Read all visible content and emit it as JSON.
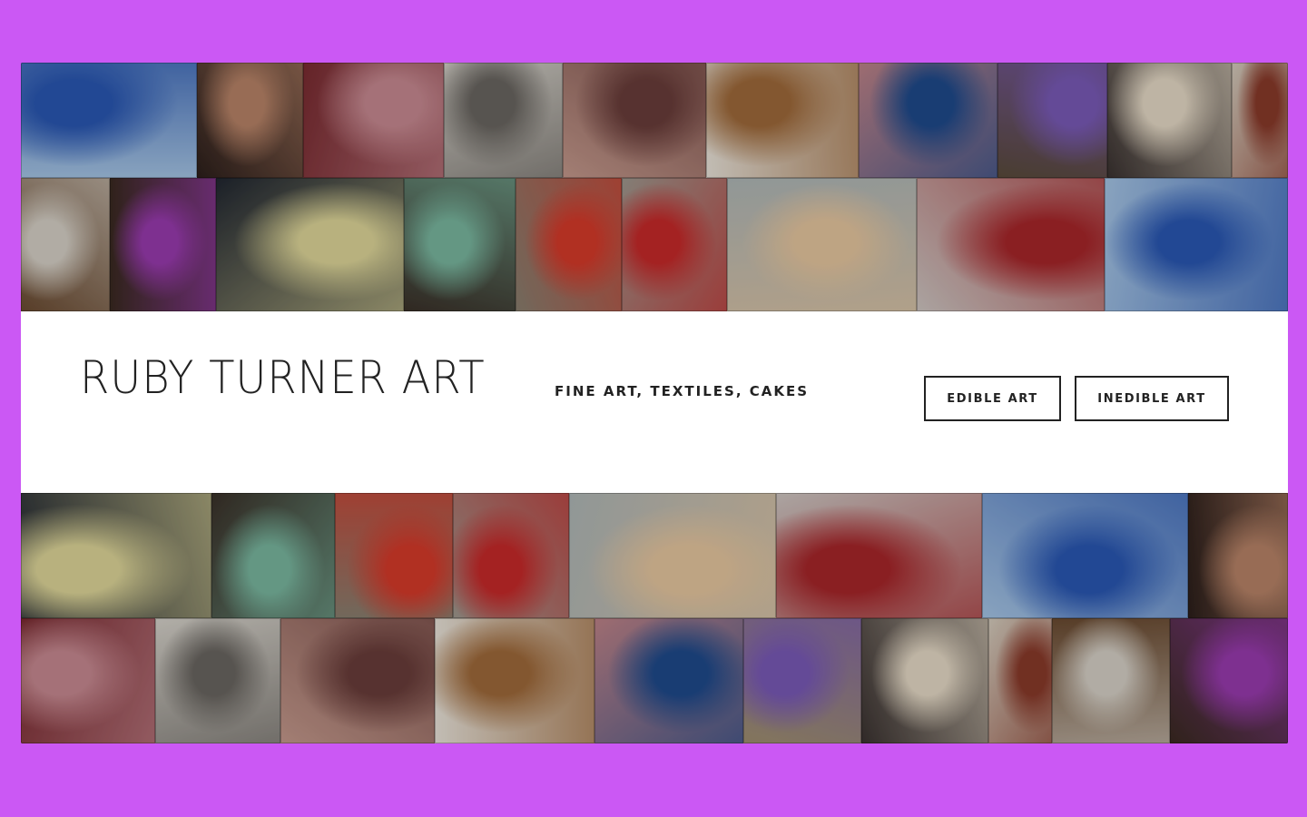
{
  "site": {
    "title": "RUBY TURNER ART",
    "tagline": "FINE ART, TEXTILES, CAKES"
  },
  "nav": {
    "edible_label": "EDIBLE ART",
    "inedible_label": "INEDIBLE ART"
  },
  "colors": {
    "page_background": "#cb58f4",
    "hero_background": "#ffffff",
    "text": "#222222"
  },
  "gallery": {
    "rows": [
      [
        {
          "subject": "water-droplet-painting",
          "colors": [
            "#a7c7e8",
            "#2a58b4"
          ]
        },
        {
          "subject": "woman-portrait-painting",
          "colors": [
            "#2b1e1a",
            "#b98468"
          ]
        },
        {
          "subject": "lips-painting",
          "colors": [
            "#7a2a30",
            "#c98a92"
          ]
        },
        {
          "subject": "man-pencil-sketch",
          "colors": [
            "#d8d4cc",
            "#6a6661"
          ]
        },
        {
          "subject": "face-closeup-painting",
          "colors": [
            "#c79b8e",
            "#6a3d3a"
          ]
        },
        {
          "subject": "clay-charms",
          "colors": [
            "#ece6dc",
            "#a06a3a"
          ]
        },
        {
          "subject": "blue-eye-painting",
          "colors": [
            "#c0848a",
            "#1e4a8c"
          ]
        },
        {
          "subject": "torso-vase-flowers",
          "colors": [
            "#5a4a3a",
            "#7a5ab8"
          ]
        },
        {
          "subject": "wedding-cake-orchids",
          "colors": [
            "#3a3230",
            "#e8dcc8"
          ]
        },
        {
          "subject": "geisha-mosaic",
          "colors": [
            "#d8cfc0",
            "#8a3a2a"
          ]
        }
      ],
      [
        {
          "subject": "torso-sculpture",
          "colors": [
            "#6a4a30",
            "#d8d2c8"
          ]
        },
        {
          "subject": "torso-vase-flowers",
          "colors": [
            "#3a2a20",
            "#9a3ab0"
          ]
        },
        {
          "subject": "tiered-cake-orange-roses",
          "colors": [
            "#202630",
            "#e0d89a"
          ]
        },
        {
          "subject": "mint-green-cake",
          "colors": [
            "#3a3028",
            "#7ab8a0"
          ]
        },
        {
          "subject": "red-haired-plush-doll",
          "colors": [
            "#8a8070",
            "#d83a2a"
          ]
        },
        {
          "subject": "red-haired-plush-doll-back",
          "colors": [
            "#a09a90",
            "#c82a2a"
          ]
        },
        {
          "subject": "two-plush-dolls",
          "colors": [
            "#b0b8b8",
            "#e8c8a0"
          ]
        },
        {
          "subject": "hand-heart-ring",
          "colors": [
            "#d0c8c4",
            "#a8262a"
          ]
        },
        {
          "subject": "water-droplet-painting",
          "colors": [
            "#a7c7e8",
            "#2a58b4"
          ]
        }
      ],
      [
        {
          "subject": "tiered-cake-orange-roses",
          "colors": [
            "#202630",
            "#e0d89a"
          ]
        },
        {
          "subject": "mint-green-cake",
          "colors": [
            "#3a3028",
            "#7ab8a0"
          ]
        },
        {
          "subject": "red-haired-plush-doll",
          "colors": [
            "#8a8070",
            "#d83a2a"
          ]
        },
        {
          "subject": "red-haired-plush-doll-back",
          "colors": [
            "#a09a90",
            "#c82a2a"
          ]
        },
        {
          "subject": "two-plush-dolls",
          "colors": [
            "#b0b8b8",
            "#e8c8a0"
          ]
        },
        {
          "subject": "hand-heart-ring",
          "colors": [
            "#d0c8c4",
            "#a8262a"
          ]
        },
        {
          "subject": "water-droplet-painting",
          "colors": [
            "#a7c7e8",
            "#2a58b4"
          ]
        },
        {
          "subject": "woman-portrait-painting",
          "colors": [
            "#2b1e1a",
            "#b98468"
          ]
        }
      ],
      [
        {
          "subject": "lips-painting",
          "colors": [
            "#7a2a30",
            "#c98a92"
          ]
        },
        {
          "subject": "man-pencil-sketch",
          "colors": [
            "#d8d4cc",
            "#6a6661"
          ]
        },
        {
          "subject": "face-closeup-painting",
          "colors": [
            "#c79b8e",
            "#6a3d3a"
          ]
        },
        {
          "subject": "clay-charms",
          "colors": [
            "#ece6dc",
            "#a06a3a"
          ]
        },
        {
          "subject": "blue-eye-painting",
          "colors": [
            "#c0848a",
            "#1e4a8c"
          ]
        },
        {
          "subject": "torso-vase-flowers",
          "colors": [
            "#a09070",
            "#7a5ab8"
          ]
        },
        {
          "subject": "wedding-cake-orchids",
          "colors": [
            "#3a3230",
            "#e8dcc8"
          ]
        },
        {
          "subject": "geisha-mosaic",
          "colors": [
            "#d8cfc0",
            "#8a3a2a"
          ]
        },
        {
          "subject": "torso-sculpture",
          "colors": [
            "#6a4a30",
            "#d8d2c8"
          ]
        },
        {
          "subject": "torso-vase-flowers",
          "colors": [
            "#3a2a20",
            "#9a3ab0"
          ]
        }
      ]
    ]
  }
}
